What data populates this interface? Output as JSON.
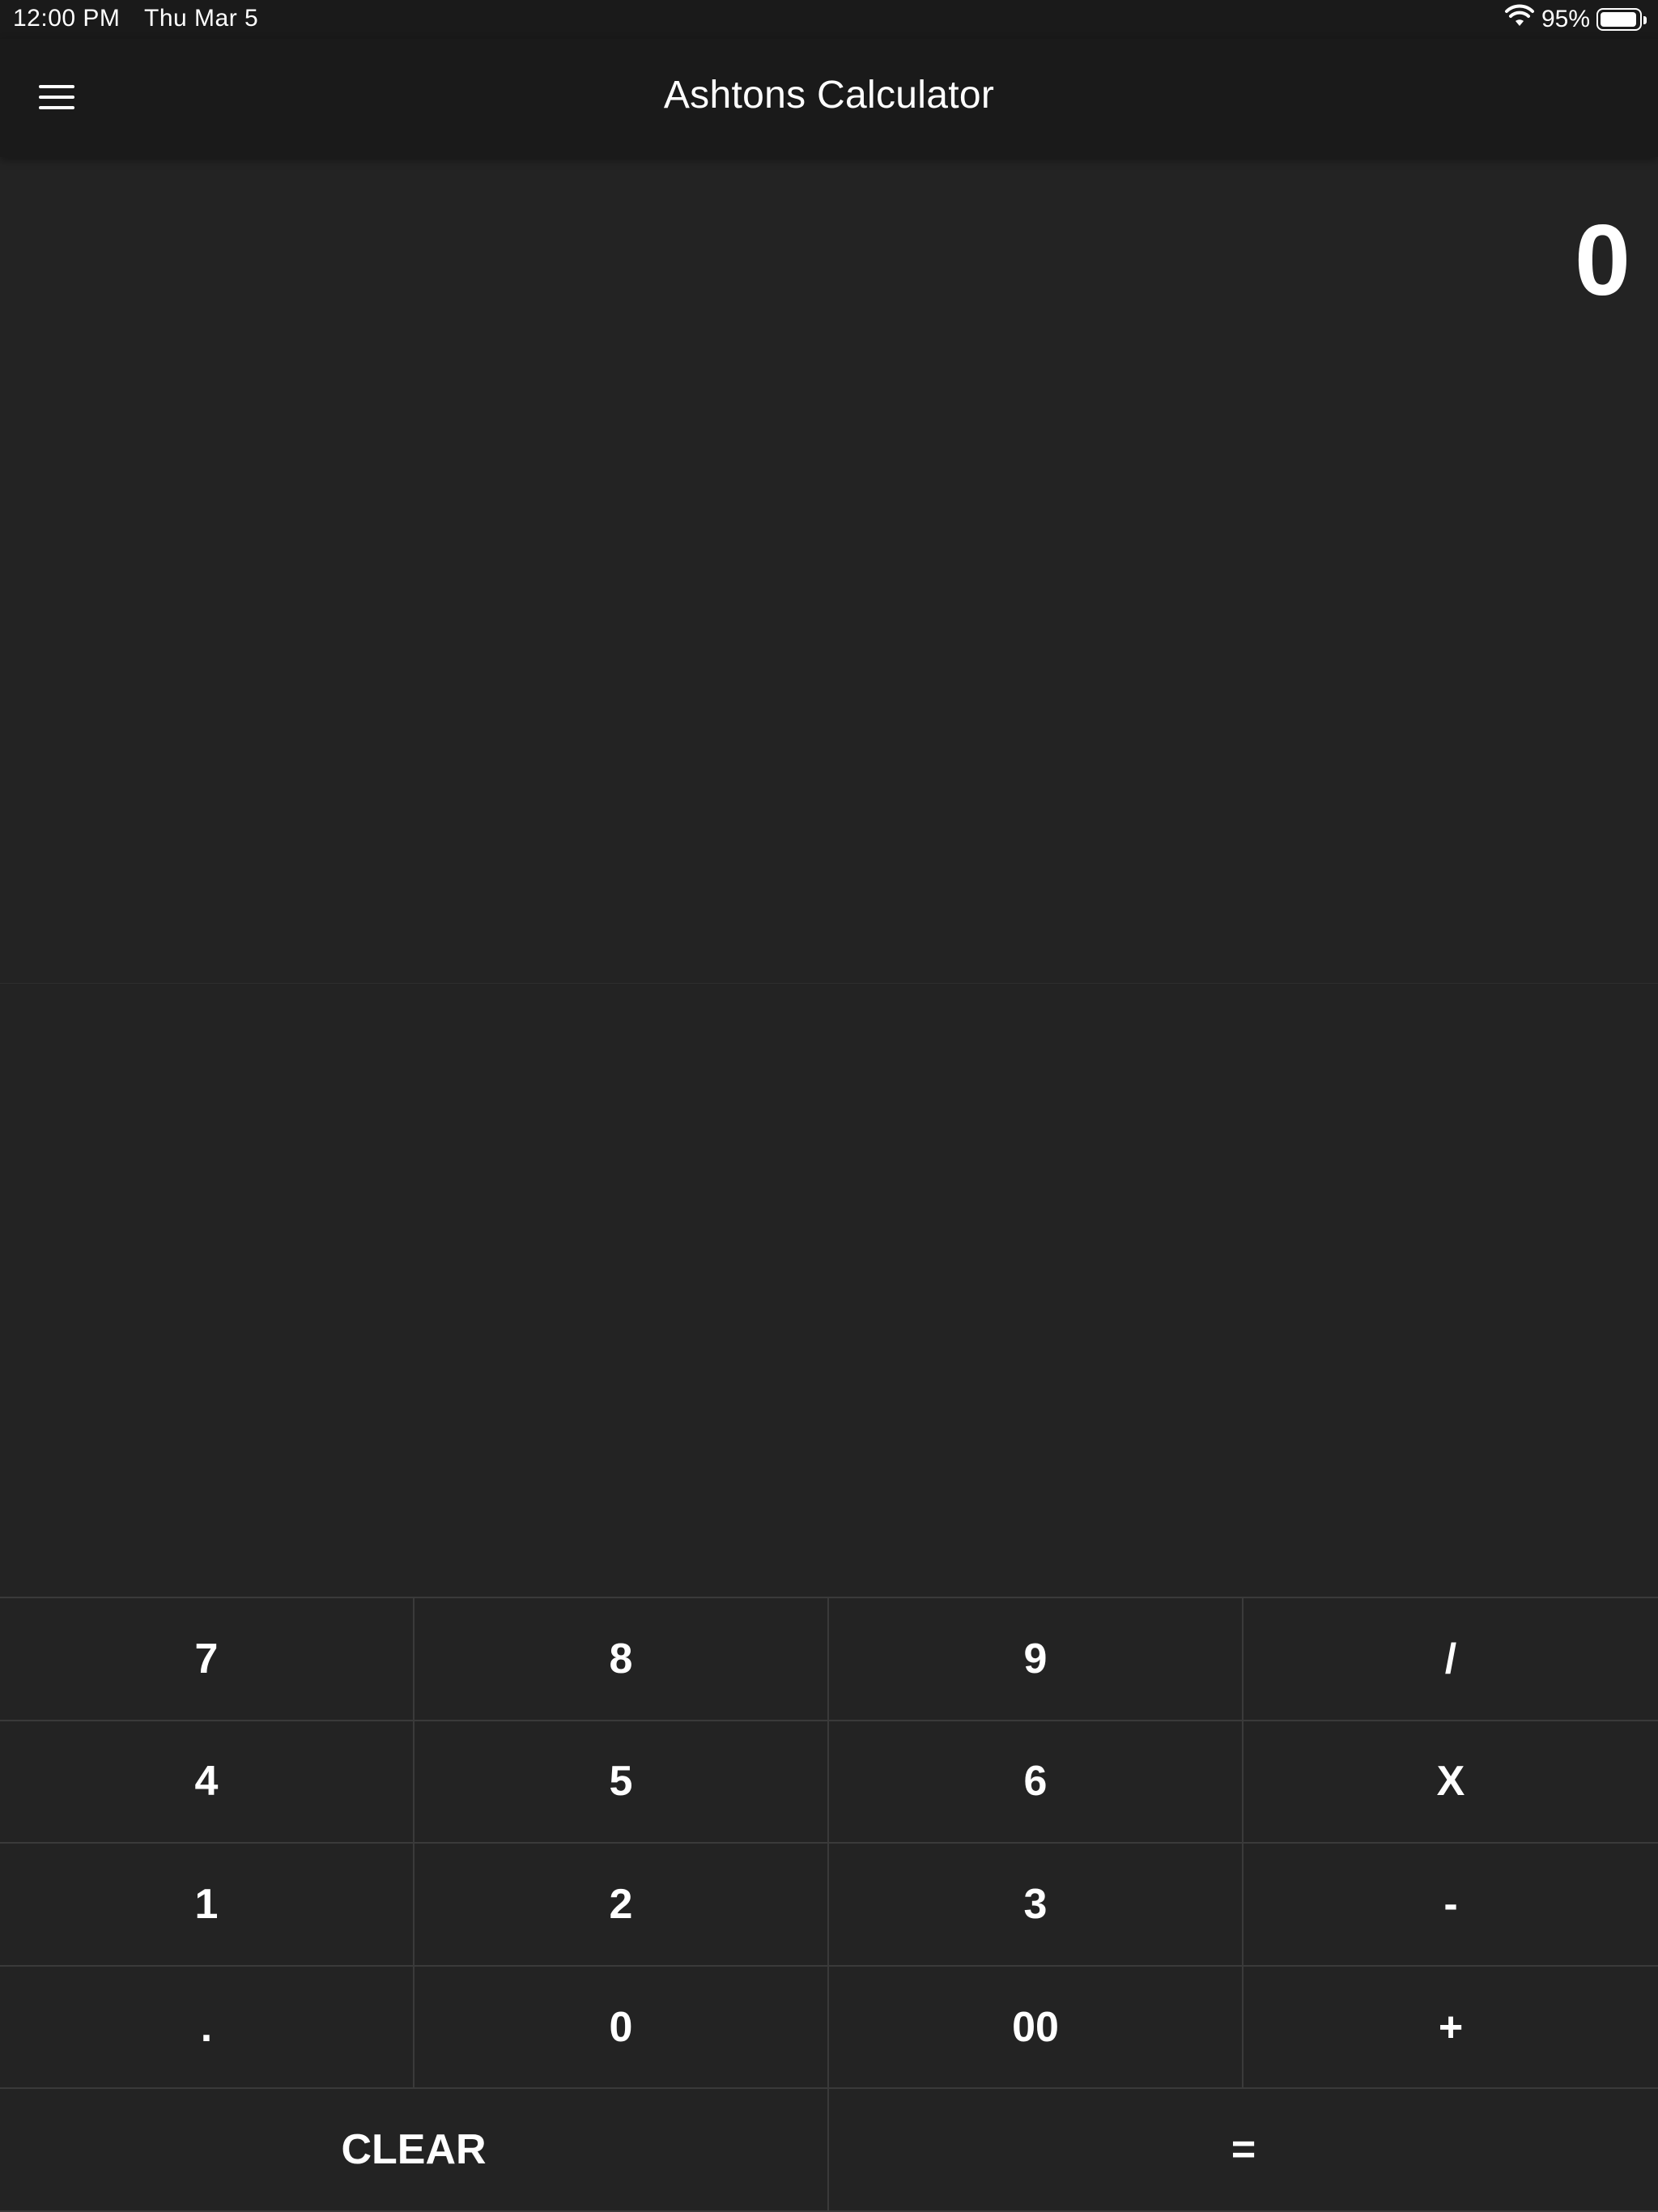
{
  "status_bar": {
    "time": "12:00 PM",
    "date": "Thu Mar 5",
    "battery_percent": "95%",
    "wifi_icon": "wifi-icon",
    "battery_icon": "battery-icon",
    "battery_level": 0.95
  },
  "header": {
    "title": "Ashtons Calculator",
    "menu_icon": "hamburger-menu-icon"
  },
  "display": {
    "value": "0"
  },
  "keypad": {
    "keys": [
      {
        "label": "7",
        "name": "key-7"
      },
      {
        "label": "8",
        "name": "key-8"
      },
      {
        "label": "9",
        "name": "key-9"
      },
      {
        "label": "/",
        "name": "key-divide"
      },
      {
        "label": "4",
        "name": "key-4"
      },
      {
        "label": "5",
        "name": "key-5"
      },
      {
        "label": "6",
        "name": "key-6"
      },
      {
        "label": "X",
        "name": "key-multiply"
      },
      {
        "label": "1",
        "name": "key-1"
      },
      {
        "label": "2",
        "name": "key-2"
      },
      {
        "label": "3",
        "name": "key-3"
      },
      {
        "label": "-",
        "name": "key-subtract"
      },
      {
        "label": ".",
        "name": "key-decimal"
      },
      {
        "label": "0",
        "name": "key-0"
      },
      {
        "label": "00",
        "name": "key-double-zero"
      },
      {
        "label": "+",
        "name": "key-add"
      },
      {
        "label": "CLEAR",
        "name": "clear-button"
      },
      {
        "label": "=",
        "name": "equals-button"
      }
    ]
  },
  "colors": {
    "background": "#232323",
    "header_background": "#1a1a1a",
    "key_border": "#3a3a3a",
    "text": "#ffffff"
  }
}
